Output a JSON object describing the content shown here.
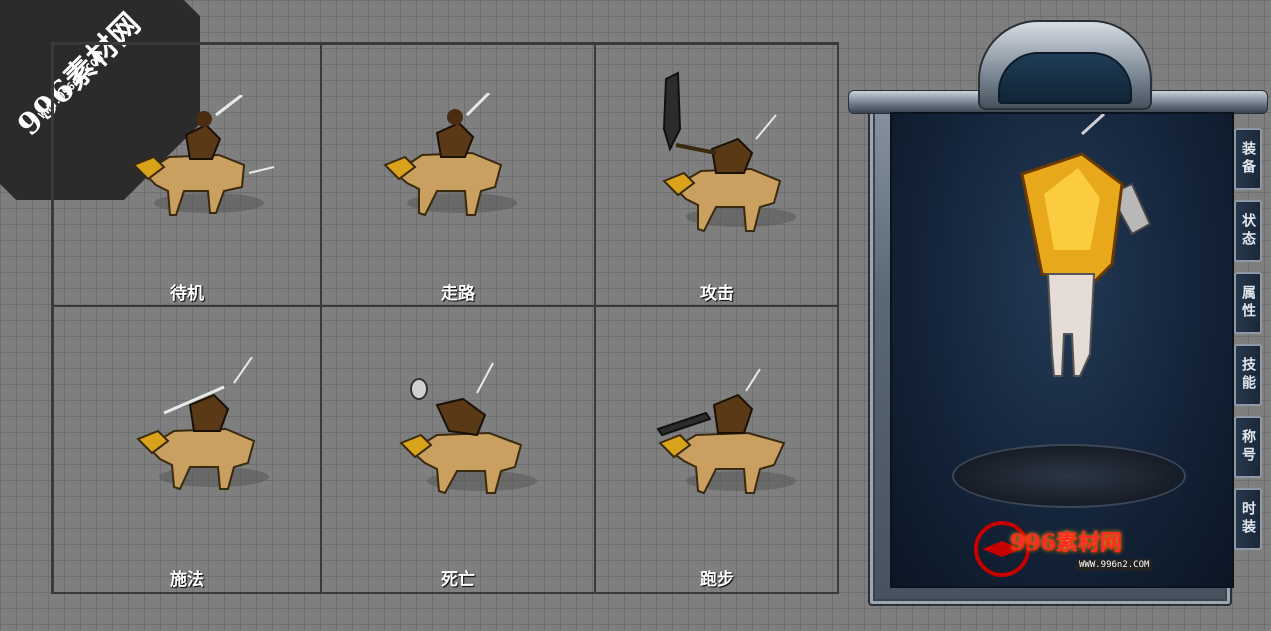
{
  "watermark": {
    "title": "996素材网",
    "url": "WWW.996n2.COM"
  },
  "animations": [
    {
      "label": "待机"
    },
    {
      "label": "走路"
    },
    {
      "label": "攻击"
    },
    {
      "label": "施法"
    },
    {
      "label": "死亡"
    },
    {
      "label": "跑步"
    }
  ],
  "character_panel": {
    "tabs": [
      "装备",
      "状态",
      "属性",
      "技能",
      "称号",
      "时装"
    ],
    "logo_title": "996素材网",
    "logo_url": "WWW.996n2.COM"
  },
  "colors": {
    "background": "#7f7f7f",
    "grid_border": "#3a3a3a",
    "label": "#ffffff",
    "viewport": "#14243a",
    "gold": "#d8a21a"
  }
}
